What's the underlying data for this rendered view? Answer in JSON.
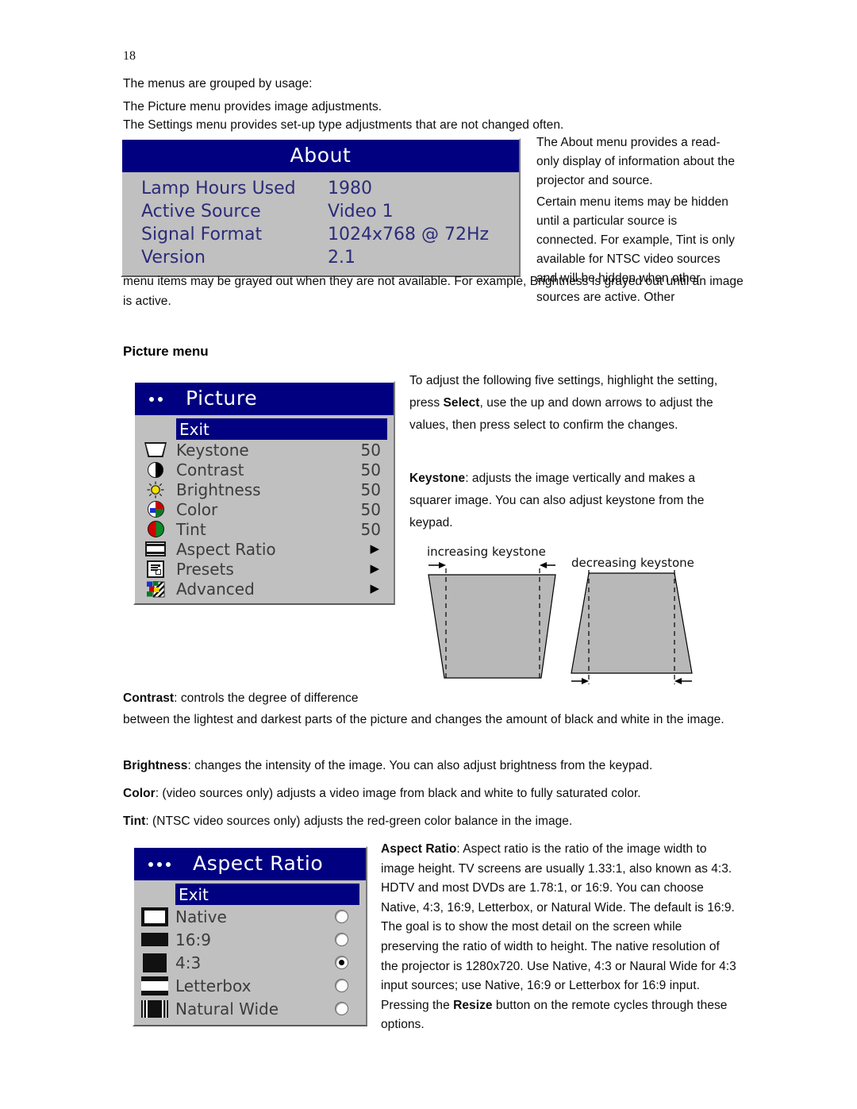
{
  "page": {
    "number": "18"
  },
  "intro": {
    "line1": "The menus are grouped by usage:",
    "line2": "The Picture menu provides image adjustments.",
    "line3": "The Settings menu provides set-up type adjustments that are not changed often."
  },
  "about_menu": {
    "title": "About",
    "rows": [
      {
        "label": "Lamp Hours Used",
        "value": "1980"
      },
      {
        "label": "Active Source",
        "value": "Video 1"
      },
      {
        "label": "Signal Format",
        "value": "1024x768 @ 72Hz"
      },
      {
        "label": "Version",
        "value": "2.1"
      }
    ]
  },
  "about_text": {
    "p1": "The About menu provides a read-only display of information about the projector and source.",
    "p2": "Certain menu items may be hidden until a particular source is connected. For example, Tint is only available for NTSC video sources and will be hidden when other sources are active. Other",
    "p3": "menu items may be grayed out when they are not available. For example, Brightness is grayed out until an image is active."
  },
  "picture_section": {
    "heading": "Picture menu"
  },
  "picture_menu": {
    "title": "Picture",
    "dots": 2,
    "exit_label": "Exit",
    "items": [
      {
        "icon": "keystone-icon",
        "label": "Keystone",
        "value": "50",
        "type": "value"
      },
      {
        "icon": "contrast-icon",
        "label": "Contrast",
        "value": "50",
        "type": "value"
      },
      {
        "icon": "brightness-icon",
        "label": "Brightness",
        "value": "50",
        "type": "value"
      },
      {
        "icon": "color-icon",
        "label": "Color",
        "value": "50",
        "type": "value"
      },
      {
        "icon": "tint-icon",
        "label": "Tint",
        "value": "50",
        "type": "value"
      },
      {
        "icon": "aspect-ratio-icon",
        "label": "Aspect Ratio",
        "value": "▶",
        "type": "submenu"
      },
      {
        "icon": "presets-icon",
        "label": "Presets",
        "value": "▶",
        "type": "submenu"
      },
      {
        "icon": "advanced-icon",
        "label": "Advanced",
        "value": "▶",
        "type": "submenu"
      }
    ]
  },
  "picture_text": {
    "p1_a": "To adjust the following five settings, highlight the setting, press ",
    "p1_b": "Select",
    "p1_c": ", use the up and down arrows to adjust the values, then press select to confirm the changes.",
    "p2_b": "Keystone",
    "p2_c": ": adjusts the image vertically and makes a squarer image. You can also adjust keystone from the keypad."
  },
  "keystone_diagram": {
    "label_left": "increasing keystone",
    "label_right": "decreasing keystone"
  },
  "setting_paragraphs": [
    {
      "term": "Contrast",
      "text": ": controls the degree of difference between the lightest and darkest parts of the picture and changes the amount of black and white in the image."
    },
    {
      "term": "Brightness",
      "text": ": changes the intensity of the image. You can also adjust brightness from the keypad."
    },
    {
      "term": "Color",
      "text": ": (video sources only) adjusts a video image from black and white to fully saturated color."
    },
    {
      "term": "Tint",
      "text": ": (NTSC video sources only) adjusts the red-green color balance in the image."
    }
  ],
  "aspect_menu": {
    "title": "Aspect Ratio",
    "dots": 3,
    "exit_label": "Exit",
    "options": [
      {
        "icon": "native-icon",
        "label": "Native",
        "selected": false
      },
      {
        "icon": "sixteen-nine-icon",
        "label": "16:9",
        "selected": false
      },
      {
        "icon": "four-three-icon",
        "label": "4:3",
        "selected": true
      },
      {
        "icon": "letterbox-icon",
        "label": "Letterbox",
        "selected": false
      },
      {
        "icon": "natural-wide-icon",
        "label": "Natural Wide",
        "selected": false
      }
    ]
  },
  "aspect_text": {
    "term": "Aspect Ratio",
    "part1": ": Aspect ratio is the ratio of the image width to image height. TV screens are usually 1.33:1, also known as 4:3. HDTV and most DVDs are 1.78:1, or 16:9. You can choose Native, 4:3, 16:9, Letterbox, or Natural Wide. The default is 16:9. The goal is to show the most detail on the screen while preserving the ratio of width to height. The native resolution of the projector is 1280x720. Use Native, 4:3 or Naural Wide for 4:3 input sources; use Native, 16:9 or Letterbox for 16:9 input. Pressing the ",
    "term2": "Resize",
    "part2": " button on the remote cycles through these options."
  },
  "colors": {
    "osd_title_bar": "#000080",
    "osd_body": "#c0c0c0",
    "osd_text": "#3c3c3c",
    "about_text": "#2b2b7a",
    "highlight": "#000080"
  }
}
